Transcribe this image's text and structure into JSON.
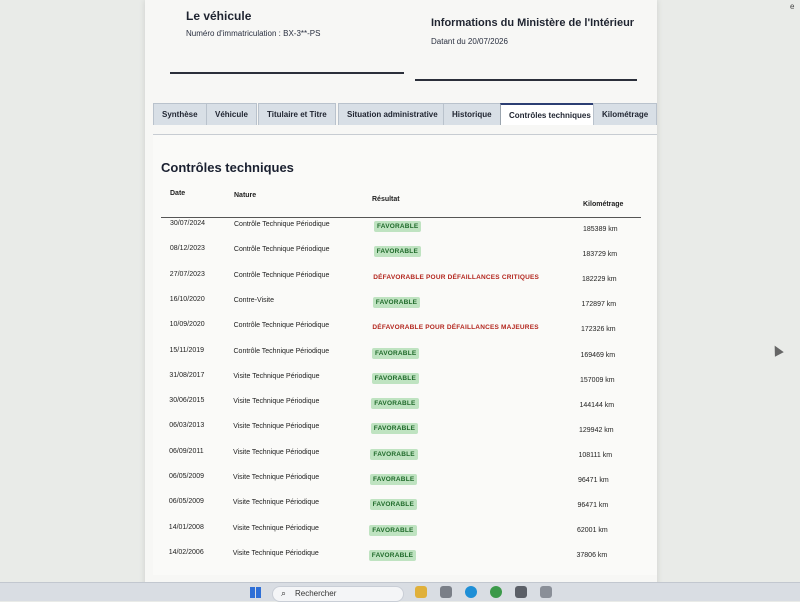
{
  "vehicle": {
    "title": "Le véhicule",
    "plate": "Numéro d'immatriculation : BX-3**-PS"
  },
  "ministry": {
    "title": "Informations du Ministère de l'Intérieur",
    "date": "Datant du 20/07/2026"
  },
  "tabs": [
    {
      "label": "Synthèse"
    },
    {
      "label": "Véhicule"
    },
    {
      "label": "Titulaire et Titre"
    },
    {
      "label": "Situation administrative"
    },
    {
      "label": "Historique"
    },
    {
      "label": "Contrôles techniques",
      "active": true
    },
    {
      "label": "Kilométrage"
    }
  ],
  "section_title": "Contrôles techniques",
  "table": {
    "headers": {
      "date": "Date",
      "nature": "Nature",
      "result": "Résultat",
      "km": "Kilométrage"
    },
    "rows": [
      {
        "date": "30/07/2024",
        "nature": "Contrôle Technique Périodique",
        "result": "FAVORABLE",
        "status": "ok",
        "km": "185389 km"
      },
      {
        "date": "08/12/2023",
        "nature": "Contrôle Technique Périodique",
        "result": "FAVORABLE",
        "status": "ok",
        "km": "183729 km"
      },
      {
        "date": "27/07/2023",
        "nature": "Contrôle Technique Périodique",
        "result": "DÉFAVORABLE POUR DÉFAILLANCES CRITIQUES",
        "status": "ko",
        "km": "182229 km"
      },
      {
        "date": "16/10/2020",
        "nature": "Contre-Visite",
        "result": "FAVORABLE",
        "status": "ok",
        "km": "172897 km"
      },
      {
        "date": "10/09/2020",
        "nature": "Contrôle Technique Périodique",
        "result": "DÉFAVORABLE POUR DÉFAILLANCES MAJEURES",
        "status": "ko",
        "km": "172326 km"
      },
      {
        "date": "15/11/2019",
        "nature": "Contrôle Technique Périodique",
        "result": "FAVORABLE",
        "status": "ok",
        "km": "169469 km"
      },
      {
        "date": "31/08/2017",
        "nature": "Visite Technique Périodique",
        "result": "FAVORABLE",
        "status": "ok",
        "km": "157009 km"
      },
      {
        "date": "30/06/2015",
        "nature": "Visite Technique Périodique",
        "result": "FAVORABLE",
        "status": "ok",
        "km": "144144 km"
      },
      {
        "date": "06/03/2013",
        "nature": "Visite Technique Périodique",
        "result": "FAVORABLE",
        "status": "ok",
        "km": "129942 km"
      },
      {
        "date": "06/09/2011",
        "nature": "Visite Technique Périodique",
        "result": "FAVORABLE",
        "status": "ok",
        "km": "108111 km"
      },
      {
        "date": "06/05/2009",
        "nature": "Visite Technique Périodique",
        "result": "FAVORABLE",
        "status": "ok",
        "km": "96471 km"
      },
      {
        "date": "06/05/2009",
        "nature": "Visite Technique Périodique",
        "result": "FAVORABLE",
        "status": "ok",
        "km": "96471 km"
      },
      {
        "date": "14/01/2008",
        "nature": "Visite Technique Périodique",
        "result": "FAVORABLE",
        "status": "ok",
        "km": "62001 km"
      },
      {
        "date": "14/02/2006",
        "nature": "Visite Technique Périodique",
        "result": "FAVORABLE",
        "status": "ok",
        "km": "37806 km"
      }
    ]
  },
  "taskbar": {
    "search_placeholder": "Rechercher",
    "search_icon": "search-icon",
    "start_icon": "windows-start-icon"
  },
  "colors": {
    "favorable_bg": "#bfe3c1",
    "favorable_text": "#1f6a2a",
    "defavorable_text": "#b3261e",
    "tab_active_border": "#2c3e73"
  }
}
